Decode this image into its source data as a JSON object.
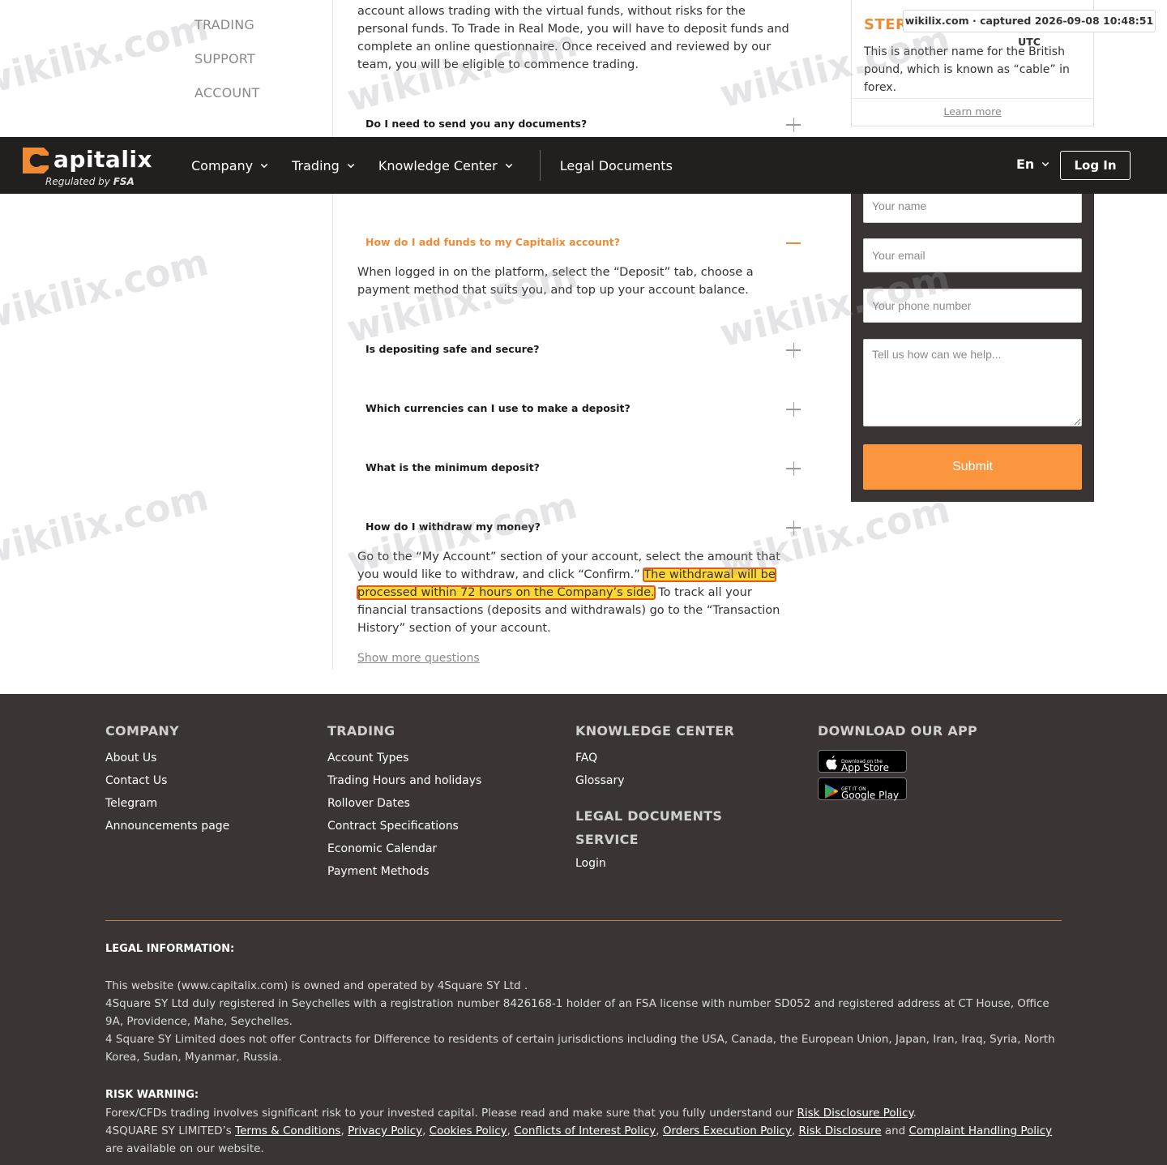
{
  "sidebar": {
    "items": [
      {
        "label": "TRADING"
      },
      {
        "label": "SUPPORT"
      },
      {
        "label": "ACCOUNT"
      }
    ]
  },
  "faq": {
    "top_paragraph": "account allows trading with the virtual funds, without risks for the personal funds. To Trade in Real Mode, you will have to deposit funds and complete an online questionnaire. Once received and reviewed by our team, you will be eligible to commence trading.",
    "questions": [
      {
        "q": "Do I need to send you any documents?"
      },
      {
        "q": "How do I add funds to my Capitalix account?",
        "a": "When logged in on the platform, select the “Deposit” tab, choose a payment method that suits you, and top up your account balance."
      },
      {
        "q": "Is depositing safe and secure?"
      },
      {
        "q": "Which currencies can I use to make a deposit?"
      },
      {
        "q": "What is the minimum deposit?"
      },
      {
        "q": "How do I withdraw my money?",
        "a_before": "Go to the “My Account” section of your account, select the amount that you would like to withdraw, and click “Confirm.”",
        "a_highlight": "The withdrawal will be processed within 72 hours on the Company’s side.",
        "a_after": "To track all your financial transactions (deposits and withdrawals) go to the “Transaction History” section of your account."
      }
    ],
    "show_more": "Show more questions"
  },
  "glossary": {
    "term": "STER",
    "definition": "This is another name for the British pound, which is known as “cable” in forex.",
    "link": "Learn more"
  },
  "capture_tag": "wikilix.com · captured 2026-09-08 10:48:51 UTC",
  "form": {
    "name_placeholder": "Your name",
    "email_placeholder": "Your email",
    "phone_placeholder": "Your phone number",
    "message_placeholder": "Tell us how can we help...",
    "submit": "Submit"
  },
  "header": {
    "logo_text": "apitalix",
    "logo_sub_prefix": "Regulated by",
    "logo_sub_bold": "FSA",
    "nav": [
      {
        "label": "Company"
      },
      {
        "label": "Trading"
      },
      {
        "label": "Knowledge Center"
      },
      {
        "label": "Legal Documents"
      }
    ],
    "lang": "En",
    "login": "Log In"
  },
  "footer": {
    "company": {
      "title": "COMPANY",
      "links": [
        "About Us",
        "Contact Us",
        "Telegram",
        "Announcements page"
      ]
    },
    "trading": {
      "title": "TRADING",
      "links": [
        "Account Types",
        "Trading Hours and holidays",
        "Rollover Dates",
        "Contract Specifications",
        "Economic Calendar",
        "Payment Methods"
      ]
    },
    "knowledge": {
      "title": "KNOWLEDGE CENTER",
      "links": [
        "FAQ",
        "Glossary"
      ],
      "legal_title": "LEGAL DOCUMENTS",
      "service_title": "SERVICE",
      "service_links": [
        "Login"
      ]
    },
    "app": {
      "title": "DOWNLOAD OUR APP",
      "appstore_small": "Download on the",
      "appstore_big": "App Store",
      "gplay_small": "GET IT ON",
      "gplay_big": "Google Play"
    },
    "legal_heading": "LEGAL INFORMATION:",
    "legal_1": "This website (www.capitalix.com) is owned and operated by 4Square SY Ltd .",
    "legal_2": "4Square SY Ltd duly registered in Seychelles with a registration number 8426168-1 holder of an FSA license with number SD052 and registered address at CT House, Office 9A, Providence, Mahe, Seychelles.",
    "legal_3": "4 Square SY Limited does not offer Contracts for Difference to residents of certain jurisdictions including the USA, Canada, the European Union, Japan, Iran, Iraq, Syria, North Korea, Sudan, Myanmar, Russia.",
    "risk_heading": "RISK WARNING:",
    "risk_1_prefix": "Forex/CFDs trading involves significant risk to your invested capital. Please read and make sure that you fully understand our",
    "risk_1_link": "Risk Disclosure Policy",
    "risk_2_prefix": "4SQUARE SY LIMITED’s",
    "risk_2_links": [
      "Terms & Conditions",
      "Privacy Policy",
      "Cookies Policy",
      "Conflicts of Interest Policy",
      "Orders Execution Policy",
      "Risk Disclosure"
    ],
    "risk_2_and": "and",
    "risk_2_last": "Complaint Handling Policy",
    "risk_2_suffix": "are available on our website."
  },
  "watermark": "wikilix.com",
  "colors": {
    "accent": "#f08b35",
    "header_bg": "#221f1f",
    "footer_bg": "#3a3534",
    "submit_bg": "#fb963e",
    "highlight": "#ffd633"
  }
}
